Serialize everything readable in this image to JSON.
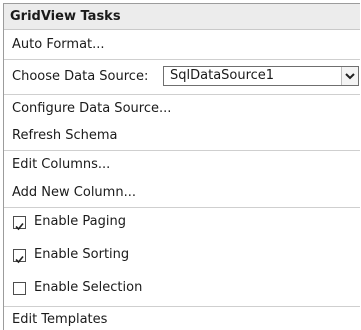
{
  "panel": {
    "title": "GridView Tasks"
  },
  "actions": {
    "auto_format": "Auto Format...",
    "choose_data_source_label": "Choose Data Source:",
    "data_source_value": "SqlDataSource1",
    "configure_data_source": "Configure Data Source...",
    "refresh_schema": "Refresh Schema",
    "edit_columns": "Edit Columns...",
    "add_new_column": "Add New Column...",
    "edit_templates": "Edit Templates"
  },
  "options": {
    "paging_label": "Enable Paging",
    "paging_checked": true,
    "sorting_label": "Enable Sorting",
    "sorting_checked": true,
    "selection_label": "Enable Selection",
    "selection_checked": false
  },
  "icons": {
    "dropdown": "chevron-down-icon",
    "checkmark": "check-icon"
  },
  "colors": {
    "title_bg": "#ececec",
    "border": "#9c9c9c",
    "separator": "#cfcfcf"
  }
}
